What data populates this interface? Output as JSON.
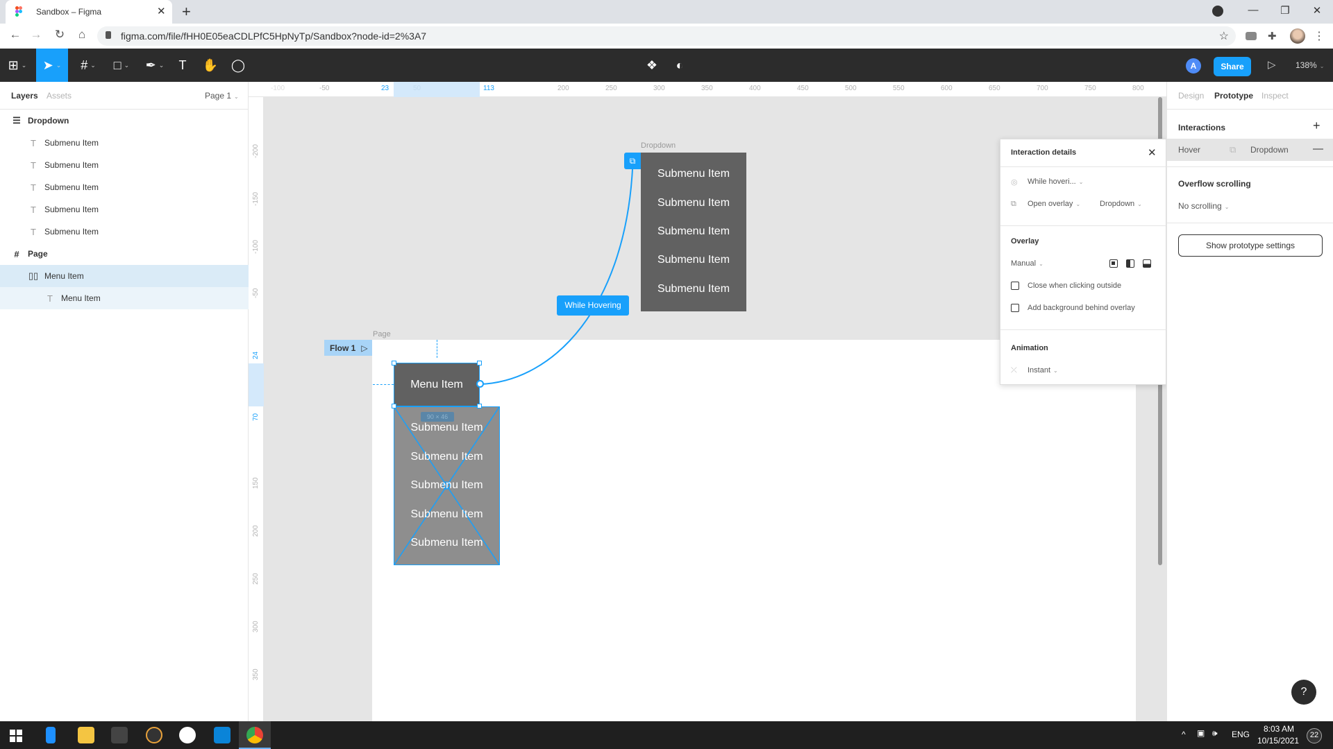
{
  "browser": {
    "tab_title": "Sandbox – Figma",
    "url": "figma.com/file/fHH0E05eaCDLPfC5HpNyTp/Sandbox?node-id=2%3A7",
    "new_tab": "+",
    "tab_close": "✕",
    "back": "←",
    "forward": "→",
    "reload": "↻",
    "home": "⌂",
    "star": "☆",
    "window_min": "—",
    "window_restore": "❐",
    "window_close": "✕",
    "more": "⋮"
  },
  "toolbar": {
    "zoom": "138%",
    "share_label": "Share",
    "avatar_initial": "A",
    "play": "▷",
    "tools": [
      "main-menu",
      "move",
      "frame",
      "shape",
      "pen",
      "text",
      "hand",
      "comment"
    ]
  },
  "left_panel": {
    "tabs": [
      "Layers",
      "Assets"
    ],
    "page_selector": "Page 1",
    "layers": [
      {
        "name": "Dropdown",
        "icon": "autolayout-vertical-icon",
        "level": 0
      },
      {
        "name": "Submenu Item",
        "icon": "text-icon",
        "level": 1
      },
      {
        "name": "Submenu Item",
        "icon": "text-icon",
        "level": 1
      },
      {
        "name": "Submenu Item",
        "icon": "text-icon",
        "level": 1
      },
      {
        "name": "Submenu Item",
        "icon": "text-icon",
        "level": 1
      },
      {
        "name": "Submenu Item",
        "icon": "text-icon",
        "level": 1
      },
      {
        "name": "Page",
        "icon": "frame-icon",
        "level": 0
      },
      {
        "name": "Menu Item",
        "icon": "autolayout-horizontal-icon",
        "level": 1,
        "selected": true
      },
      {
        "name": "Menu Item",
        "icon": "text-icon",
        "level": 2,
        "child_selected": true
      }
    ]
  },
  "rulers": {
    "horizontal": [
      "-100",
      "-50",
      "23",
      "50",
      "113",
      "200",
      "250",
      "300",
      "350",
      "400",
      "450",
      "500",
      "550",
      "600",
      "650",
      "700",
      "750",
      "800"
    ],
    "horizontal_highlight": [
      "23",
      "113"
    ],
    "vertical": [
      "-200",
      "-150",
      "-100",
      "-50",
      "24",
      "70",
      "150",
      "200",
      "250",
      "300",
      "350"
    ],
    "vertical_highlight": [
      "24",
      "70"
    ]
  },
  "canvas": {
    "dropdown_frame_label": "Dropdown",
    "dropdown_items": [
      "Submenu Item",
      "Submenu Item",
      "Submenu Item",
      "Submenu Item",
      "Submenu Item"
    ],
    "connection_label": "While Hovering",
    "page_frame_label": "Page",
    "flow_label": "Flow 1",
    "menu_item_label": "Menu Item",
    "size_badge": "90 × 46",
    "overlay_preview_items": [
      "Submenu Item",
      "Submenu Item",
      "Submenu Item",
      "Submenu Item",
      "Submenu Item"
    ],
    "help": "?"
  },
  "interaction_popup": {
    "title": "Interaction details",
    "trigger": "While hoveri...",
    "action": "Open overlay",
    "destination": "Dropdown",
    "overlay_heading": "Overlay",
    "position": "Manual",
    "close_outside_label": "Close when clicking outside",
    "close_outside_checked": false,
    "add_background_label": "Add background behind overlay",
    "add_background_checked": false,
    "animation_heading": "Animation",
    "animation": "Instant"
  },
  "right_panel": {
    "tabs": [
      "Design",
      "Prototype",
      "Inspect"
    ],
    "active_tab": "Prototype",
    "interactions_heading": "Interactions",
    "interaction": {
      "trigger": "Hover",
      "destination": "Dropdown"
    },
    "overflow_heading": "Overflow scrolling",
    "overflow_value": "No scrolling",
    "settings_button": "Show prototype settings"
  },
  "taskbar": {
    "time": "8:03 AM",
    "date": "10/15/2021",
    "lang": "ENG",
    "notifications": "22"
  },
  "colors": {
    "accent": "#18a0fb",
    "toolbar_bg": "#2c2c2c",
    "canvas_bg": "#e5e5e5",
    "menu_fill": "#616161",
    "selection_bg": "#daebf7"
  }
}
